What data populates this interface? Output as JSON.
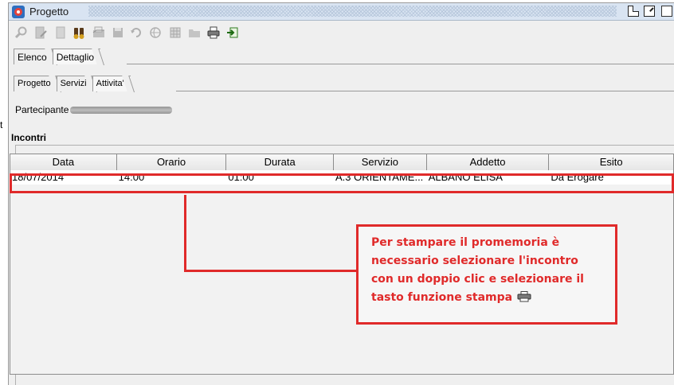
{
  "window": {
    "title": "Progetto"
  },
  "left_strip": {
    "mark": "t"
  },
  "toolbar": {
    "icons": [
      "search-icon",
      "edit-icon",
      "new-document-icon",
      "binoculars-icon",
      "folder-open-icon",
      "save-icon",
      "undo-icon",
      "globe-icon",
      "grid-icon",
      "folder-icon",
      "printer-icon",
      "export-icon"
    ]
  },
  "tabs_outer": [
    {
      "label": "Elenco",
      "active": false
    },
    {
      "label": "Dettaglio",
      "active": true
    }
  ],
  "tabs_inner": [
    {
      "label": "Progetto",
      "active": false
    },
    {
      "label": "Servizi",
      "active": false
    },
    {
      "label": "Attivita'",
      "active": true
    }
  ],
  "participant": {
    "label": "Partecipante"
  },
  "incontri": {
    "legend": "Incontri",
    "columns": [
      "Data",
      "Orario",
      "Durata",
      "Servizio",
      "Addetto",
      "Esito"
    ],
    "rows": [
      [
        "18/07/2014",
        "14:00",
        "01:00",
        "A.3 ORIENTAME...",
        "ALBANO ELISA",
        "Da Erogare"
      ]
    ]
  },
  "callout": {
    "lines": [
      "Per stampare il promemoria è",
      "necessario selezionare  l'incontro",
      "con un doppio clic e selezionare il",
      "tasto funzione stampa"
    ],
    "icon": "printer-icon"
  },
  "colors": {
    "annotation_red": "#e02a2a",
    "titlebar_bg": "#d9e4f2",
    "window_bg": "#efefef"
  }
}
